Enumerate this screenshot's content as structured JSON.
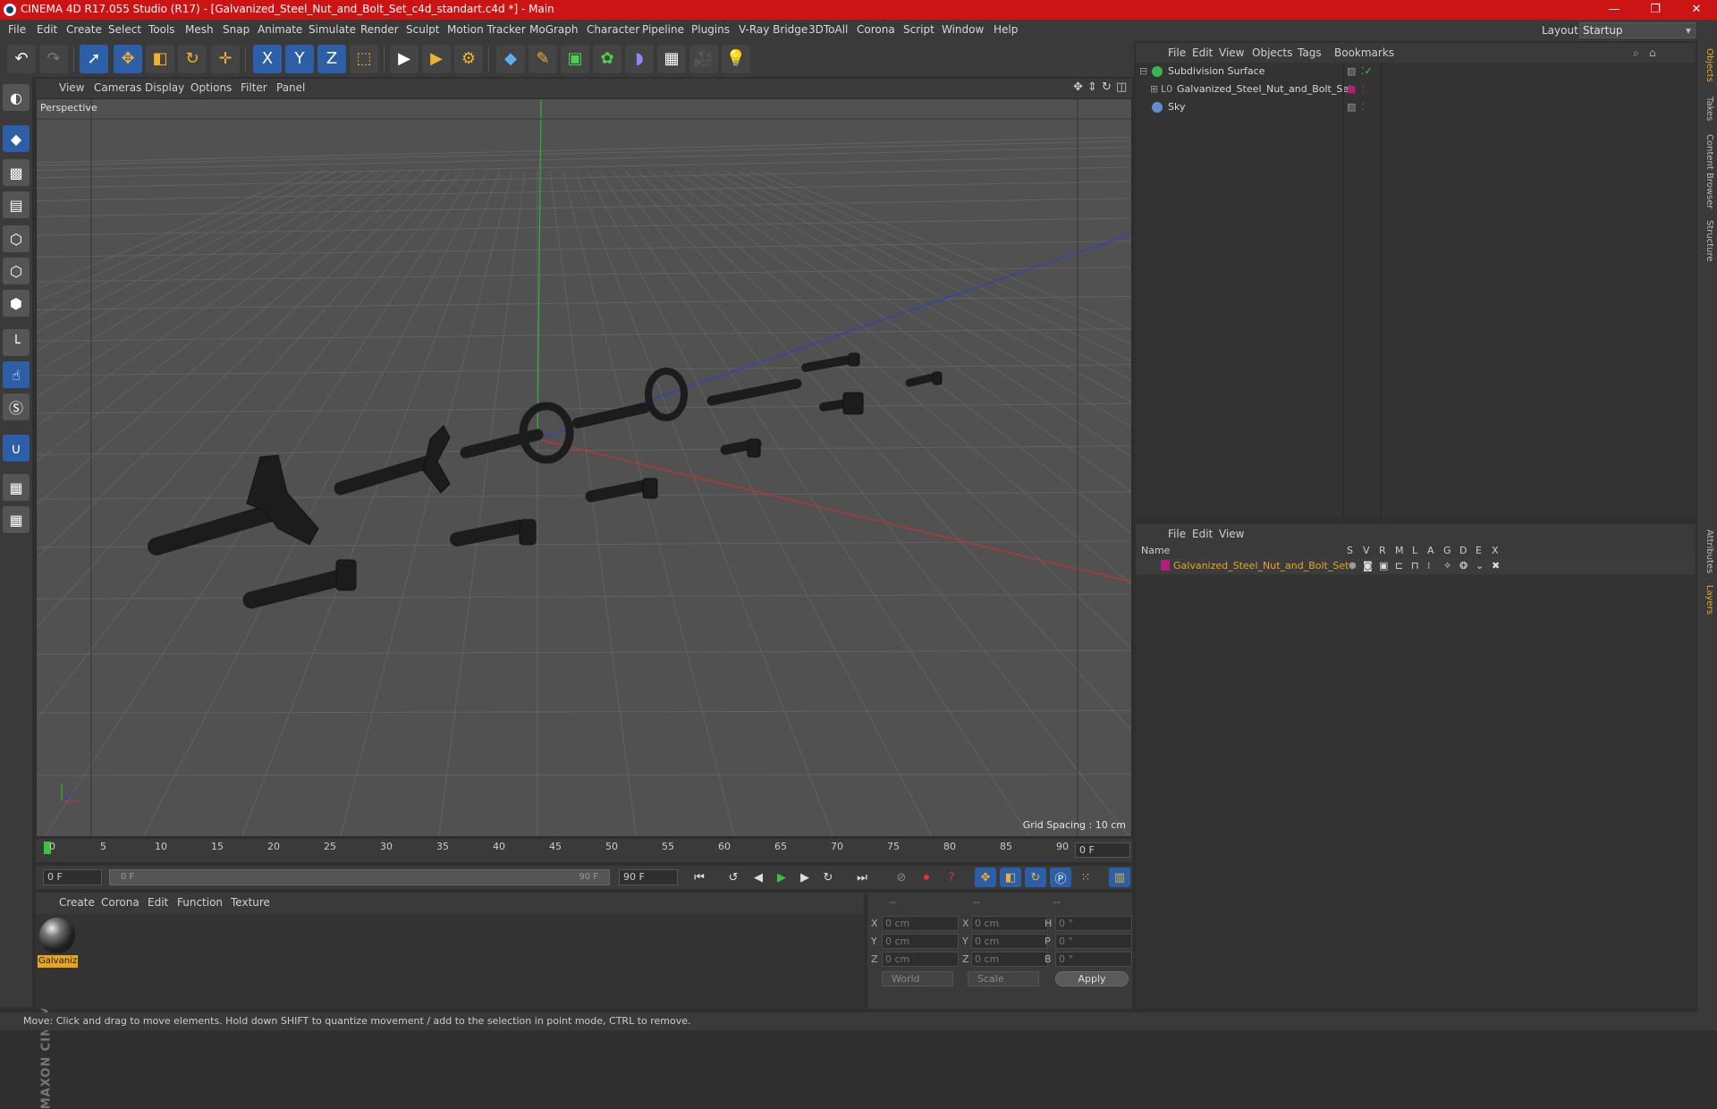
{
  "window": {
    "title": "CINEMA 4D R17.055 Studio (R17) - [Galvanized_Steel_Nut_and_Bolt_Set_c4d_standart.c4d *] - Main",
    "controls": [
      "—",
      "❐",
      "✕"
    ]
  },
  "menubar": {
    "items": [
      "File",
      "Edit",
      "Create",
      "Select",
      "Tools",
      "Mesh",
      "Snap",
      "Animate",
      "Simulate",
      "Render",
      "Sculpt",
      "Motion Tracker",
      "MoGraph",
      "Character",
      "Pipeline",
      "Plugins",
      "V-Ray Bridge",
      "3DToAll",
      "Corona",
      "Script",
      "Window",
      "Help"
    ],
    "layout_label": "Layout:",
    "layout_value": "Startup"
  },
  "toolbar": {
    "buttons": [
      "undo-icon",
      "redo-icon",
      "select-icon",
      "move-icon",
      "scale-icon",
      "rotate-icon",
      "add-icon",
      "x-axis-icon",
      "y-axis-icon",
      "z-axis-icon",
      "coord-system-icon",
      "render-view-icon",
      "render-picture-viewer-icon",
      "edit-render-settings-icon",
      "cube-icon",
      "pen-icon",
      "subdivision-icon",
      "mograph-icon",
      "deformer-icon",
      "scene-icon",
      "camera-icon",
      "light-icon"
    ],
    "axis_labels": [
      "X",
      "Y",
      "Z"
    ]
  },
  "viewport": {
    "menu": [
      "View",
      "Cameras",
      "Display",
      "Options",
      "Filter",
      "Panel"
    ],
    "label": "Perspective",
    "grid_spacing": "Grid Spacing : 10 cm",
    "colors": {
      "background": "#515151",
      "grid": "#626262",
      "x_axis": "#c83232",
      "y_axis": "#2fb32f",
      "z_axis": "#3040c0",
      "model": "#1c1c1c"
    }
  },
  "timeline": {
    "ticks": [
      "0",
      "5",
      "10",
      "15",
      "20",
      "25",
      "30",
      "35",
      "40",
      "45",
      "50",
      "55",
      "60",
      "65",
      "70",
      "75",
      "80",
      "85",
      "90"
    ],
    "current_frame": "0 F"
  },
  "transport": {
    "start_field": "0 F",
    "range_start": "0 F",
    "range_end": "90 F",
    "end_field": "90 F"
  },
  "material_manager": {
    "menu": [
      "Create",
      "Corona",
      "Edit",
      "Function",
      "Texture"
    ],
    "materials": [
      {
        "name": "Galvaniz"
      }
    ]
  },
  "coordinates": {
    "headers": [
      "--",
      "--",
      "--"
    ],
    "rows": [
      {
        "l1": "X",
        "v1": "0 cm",
        "l2": "X",
        "v2": "0 cm",
        "l3": "H",
        "v3": "0 °"
      },
      {
        "l1": "Y",
        "v1": "0 cm",
        "l2": "Y",
        "v2": "0 cm",
        "l3": "P",
        "v3": "0 °"
      },
      {
        "l1": "Z",
        "v1": "0 cm",
        "l2": "Z",
        "v2": "0 cm",
        "l3": "B",
        "v3": "0 °"
      }
    ],
    "mode_world": "World",
    "mode_scale": "Scale",
    "apply": "Apply"
  },
  "status": "Move: Click and drag to move elements. Hold down SHIFT to quantize movement / add to the selection in point mode, CTRL to remove.",
  "object_manager": {
    "menu": [
      "File",
      "Edit",
      "View",
      "Objects",
      "Tags",
      "Bookmarks"
    ],
    "objects": [
      {
        "name": "Subdivision Surface",
        "icon_color": "#3fb34a"
      },
      {
        "name": "Galvanized_Steel_Nut_and_Bolt_Set",
        "icon_color": "#9a9a9a",
        "tag_color": "#b0207a"
      },
      {
        "name": "Sky",
        "icon_color": "#5f8fd0"
      }
    ]
  },
  "layer_manager": {
    "menu": [
      "File",
      "Edit",
      "View"
    ],
    "columns": [
      "Name",
      "S",
      "V",
      "R",
      "M",
      "L",
      "A",
      "G",
      "D",
      "E",
      "X"
    ],
    "layers": [
      {
        "name": "Galvanized_Steel_Nut_and_Bolt_Set",
        "color": "#b0207a"
      }
    ]
  },
  "right_tabs": [
    "Objects",
    "Takes",
    "Content Browser",
    "Structure",
    "Attributes",
    "Layers"
  ]
}
